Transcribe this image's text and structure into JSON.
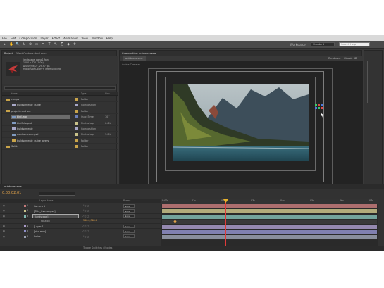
{
  "menu": [
    "File",
    "Edit",
    "Composition",
    "Layer",
    "Effect",
    "Animation",
    "View",
    "Window",
    "Help"
  ],
  "toolbar": {
    "tools": [
      "▸",
      "✋",
      "🔍",
      "↻",
      "⊕",
      "▭",
      "✒",
      "T",
      "✎",
      "⎘",
      "◆",
      "✚"
    ],
    "workspace_label": "Workspace:",
    "workspace_value": "Standard",
    "search_placeholder": "Search Help"
  },
  "project": {
    "tabs": [
      "Project",
      "Effect Controls: bird.mov"
    ],
    "meta": [
      "landscape_comp1.fam",
      "1000 x 720 (1.00)",
      "Δ 0;00;08;07, 29.97 fps",
      "Millions of Colors+ (Premultiplied)"
    ],
    "columns": {
      "name": "Name",
      "type": "Type",
      "size": "Size"
    },
    "items": [
      {
        "name": "comps",
        "type": "Folder",
        "size": "",
        "indent": 0,
        "kind": "folder",
        "tag": "#c9a44a",
        "selected": false
      },
      {
        "name": "buildscreenie_guide",
        "type": "Composition",
        "size": "",
        "indent": 1,
        "kind": "comp",
        "tag": "#a8a8c8",
        "selected": false
      },
      {
        "name": "projects and ant",
        "type": "Folder",
        "size": "",
        "indent": 0,
        "kind": "folder",
        "tag": "#c9a44a",
        "selected": false
      },
      {
        "name": "bird.mov",
        "type": "QuickTime",
        "size": "707",
        "indent": 1,
        "kind": "file",
        "tag": "#6b7fb8",
        "selected": true
      },
      {
        "name": "birdfolio.psd",
        "type": "Photoshop",
        "size": "6.6 k",
        "indent": 1,
        "kind": "file",
        "tag": "#c9c28a",
        "selected": false
      },
      {
        "name": "buildscreenie",
        "type": "Composition",
        "size": "",
        "indent": 1,
        "kind": "comp",
        "tag": "#a8a8c8",
        "selected": false
      },
      {
        "name": "outdoorscene.psd",
        "type": "Photoshop",
        "size": "7.0 k",
        "indent": 1,
        "kind": "file",
        "tag": "#c9c28a",
        "selected": false
      },
      {
        "name": "buildscreenie_guide layers",
        "type": "Folder",
        "size": "",
        "indent": 1,
        "kind": "folder",
        "tag": "#c9a44a",
        "selected": false
      },
      {
        "name": "Solids",
        "type": "Folder",
        "size": "",
        "indent": 0,
        "kind": "folder",
        "tag": "#c9a44a",
        "selected": false
      }
    ],
    "footer": "8 bpc"
  },
  "composition": {
    "tab": "Composition: outdoorscene",
    "sub_tab": "outdoorscene",
    "renderer_label": "Renderer:",
    "renderer_value": "Classic 3D",
    "view_label": "Active Camera",
    "footer": {
      "zoom": "50%",
      "time": "0;00;02;01",
      "quality": "Quarter",
      "camera": "Active Camera",
      "views": "1 View"
    }
  },
  "timeline": {
    "tab": "outdoorscene",
    "current_time": "0;00;02;01",
    "columns": {
      "layer_name": "Layer Name",
      "parent": "Parent"
    },
    "layers": [
      {
        "index": "1",
        "name": "Camera 1",
        "color": "#c47a7a",
        "parent": "None",
        "selected": false,
        "kind": "layer"
      },
      {
        "index": "2",
        "name": "[Title_Overlay.psd]",
        "color": "#c9c28a",
        "parent": "None",
        "selected": false,
        "kind": "layer"
      },
      {
        "index": "3",
        "name": "[landscape]",
        "color": "#7fb8b0",
        "parent": "None",
        "selected": true,
        "kind": "layer"
      },
      {
        "index": "",
        "name": "Position",
        "value": "500.0,360.0",
        "color": "",
        "parent": "",
        "selected": false,
        "kind": "prop"
      },
      {
        "index": "4",
        "name": "[Layer 1]",
        "color": "#a89ac8",
        "parent": "None",
        "selected": false,
        "kind": "layer"
      },
      {
        "index": "5",
        "name": "[bird.mov]",
        "color": "#8f8fc8",
        "parent": "None",
        "selected": false,
        "kind": "layer"
      },
      {
        "index": "6",
        "name": "Solids",
        "color": "#9aa0b0",
        "parent": "None",
        "selected": false,
        "kind": "layer"
      }
    ],
    "ruler": [
      "0:00s",
      "01s",
      "02s",
      "03s",
      "04s",
      "05s",
      "06s",
      "07s"
    ],
    "footer": "Toggle Switches / Modes"
  }
}
